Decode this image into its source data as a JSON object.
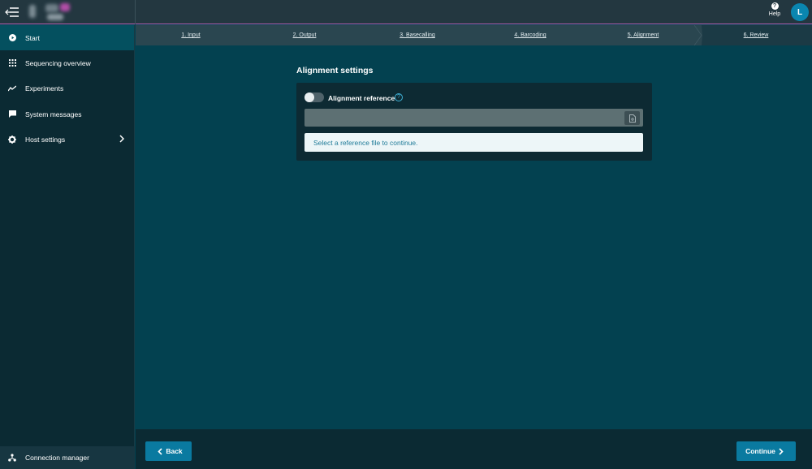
{
  "header": {
    "help_label": "Help",
    "help_glyph": "?",
    "avatar_initial": "L",
    "accent_line_color": "#b75fb1"
  },
  "sidebar": {
    "items": [
      {
        "label": "Start",
        "icon": "play-circle-icon",
        "active": true
      },
      {
        "label": "Sequencing overview",
        "icon": "grid-icon"
      },
      {
        "label": "Experiments",
        "icon": "trend-line-icon"
      },
      {
        "label": "System messages",
        "icon": "message-icon"
      },
      {
        "label": "Host settings",
        "icon": "gear-icon",
        "has_submenu": true
      }
    ],
    "footer_item": {
      "label": "Connection manager",
      "icon": "network-icon"
    }
  },
  "steps": [
    {
      "label": "1. Input"
    },
    {
      "label": "2. Output"
    },
    {
      "label": "3. Basecalling"
    },
    {
      "label": "4. Barcoding"
    },
    {
      "label": "5. Alignment"
    },
    {
      "label": "6. Review"
    }
  ],
  "main": {
    "title": "Alignment settings",
    "toggle_label": "Alignment reference",
    "info_glyph": "?",
    "reference_value": "",
    "alert_text": "Select a reference file to continue."
  },
  "footer": {
    "back_label": "Back",
    "continue_label": "Continue",
    "button_color": "#0a7aa0"
  }
}
